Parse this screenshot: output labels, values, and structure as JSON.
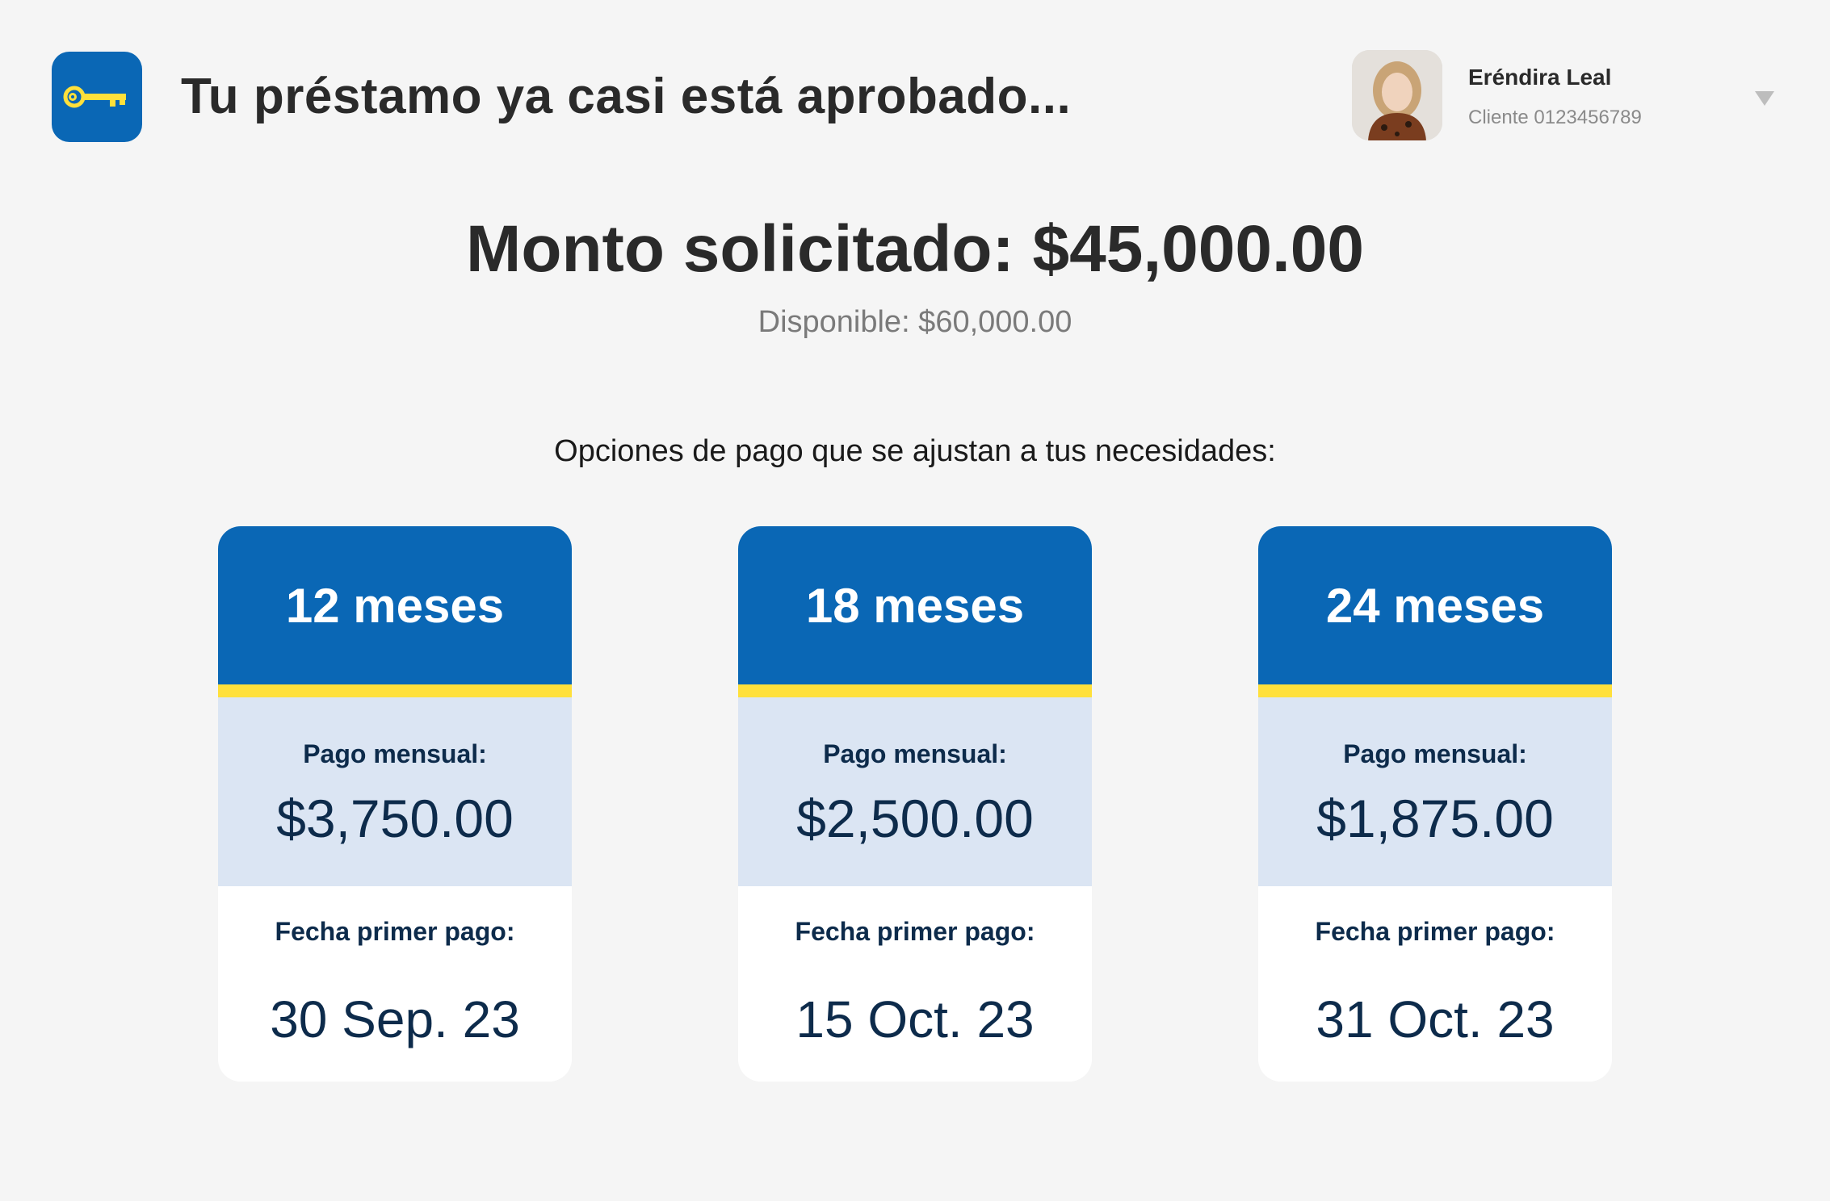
{
  "header": {
    "title": "Tu préstamo ya casi está aprobado...",
    "logo_icon": "key-icon"
  },
  "user": {
    "name": "Eréndira Leal",
    "client_id": "Cliente 0123456789",
    "menu_icon": "chevron-down-icon"
  },
  "loan": {
    "requested": "Monto solicitado: $45,000.00",
    "available": "Disponible: $60,000.00"
  },
  "options_heading": "Opciones de pago que se ajustan a tus necesidades:",
  "plans": [
    {
      "term": "12 meses",
      "monthly_label": "Pago mensual:",
      "monthly_value": "$3,750.00",
      "date_label": "Fecha primer pago:",
      "date_value": "30 Sep. 23"
    },
    {
      "term": "18 meses",
      "monthly_label": "Pago mensual:",
      "monthly_value": "$2,500.00",
      "date_label": "Fecha primer pago:",
      "date_value": "15 Oct. 23"
    },
    {
      "term": "24 meses",
      "monthly_label": "Pago mensual:",
      "monthly_value": "$1,875.00",
      "date_label": "Fecha primer pago:",
      "date_value": "31 Oct. 23"
    }
  ],
  "colors": {
    "brand_blue": "#0a67b5",
    "accent_yellow": "#ffe03b",
    "light_blue": "#dbe5f3",
    "navy_text": "#0d2b4b",
    "background": "#f5f5f5"
  }
}
